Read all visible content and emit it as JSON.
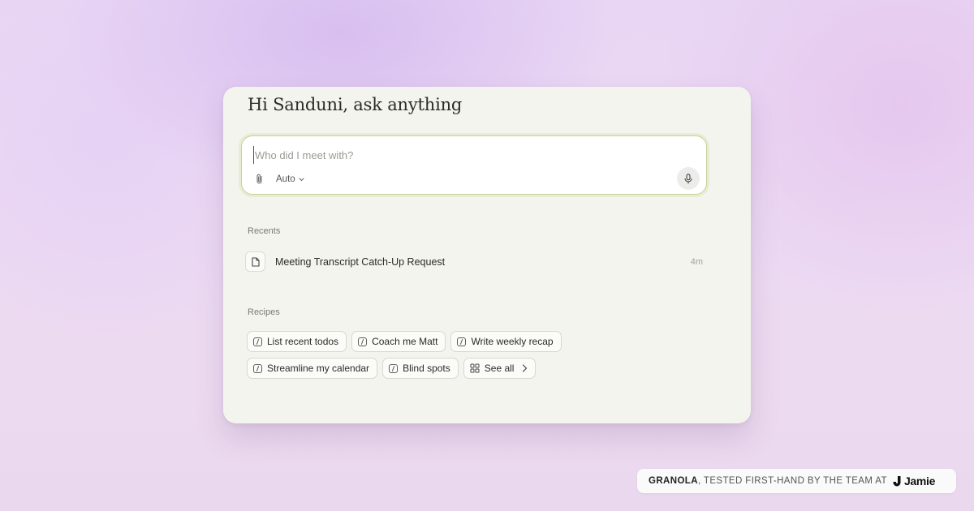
{
  "greeting": "Hi Sanduni, ask anything",
  "ask": {
    "placeholder": "Who did I meet with?",
    "model_label": "Auto"
  },
  "recents": {
    "label": "Recents",
    "items": [
      {
        "title": "Meeting Transcript Catch-Up Request",
        "time": "4m"
      }
    ]
  },
  "recipes": {
    "label": "Recipes",
    "chips": [
      "List recent todos",
      "Coach me Matt",
      "Write weekly recap",
      "Streamline my calendar",
      "Blind spots"
    ],
    "see_all": "See all"
  },
  "badge": {
    "brand": "GRANOLA",
    "text": ", TESTED FIRST-HAND BY THE TEAM AT",
    "logo_text": "Jamie"
  },
  "icons": {
    "attach": "paperclip-icon",
    "model_chevron": "chevron-down-icon",
    "mic": "microphone-icon",
    "document": "document-icon",
    "recipe": "slash-command-icon",
    "see_all": "grid-icon",
    "see_all_arrow": "chevron-right-icon",
    "logo": "jamie-logo"
  },
  "colors": {
    "card_background": "#f4f4ef",
    "input_border": "#c8cf9a",
    "page_background": "#ead8f2"
  }
}
